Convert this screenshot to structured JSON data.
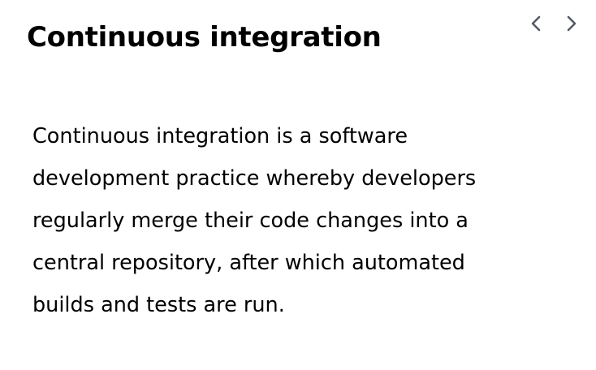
{
  "card": {
    "title": "Continuous integration",
    "body": "Continuous integration is a software development practice whereby developers regularly merge their code changes into a central repository, after which automated builds and tests are run."
  },
  "navigation": {
    "previous_icon": "chevron-left-icon",
    "next_icon": "chevron-right-icon"
  },
  "colors": {
    "text": "#000000",
    "icon": "#545b64",
    "background": "#ffffff"
  }
}
